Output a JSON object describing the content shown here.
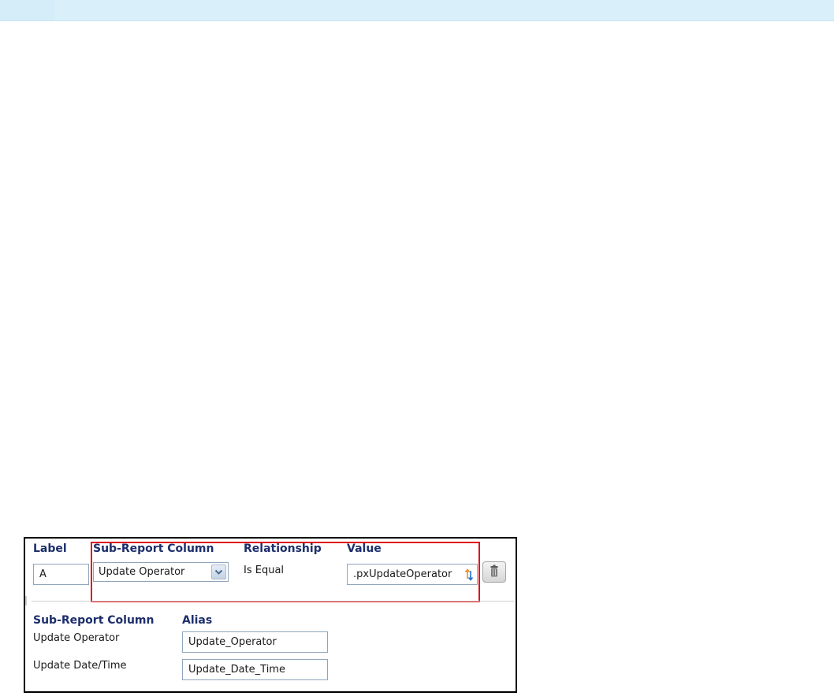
{
  "filter_row": {
    "headers": {
      "label": "Label",
      "sub_report_column": "Sub-Report Column",
      "relationship": "Relationship",
      "value": "Value"
    },
    "label_value": "A",
    "sub_report_column_selected": "Update Operator",
    "relationship_value": "Is Equal",
    "value_field": ".pxUpdateOperator"
  },
  "columns_section": {
    "headers": {
      "sub_report_column": "Sub-Report Column",
      "alias": "Alias"
    },
    "rows": [
      {
        "column": "Update Operator",
        "alias": "Update_Operator"
      },
      {
        "column": "Update Date/Time",
        "alias": "Update_Date_Time"
      }
    ]
  },
  "colors": {
    "header_text": "#1c2e6b",
    "highlight": "#e0121b",
    "top_bar": "#d9f0fb"
  },
  "icons": {
    "dropdown": "chevron-down-icon",
    "sort": "sort-arrows-icon",
    "delete": "trash-icon"
  }
}
